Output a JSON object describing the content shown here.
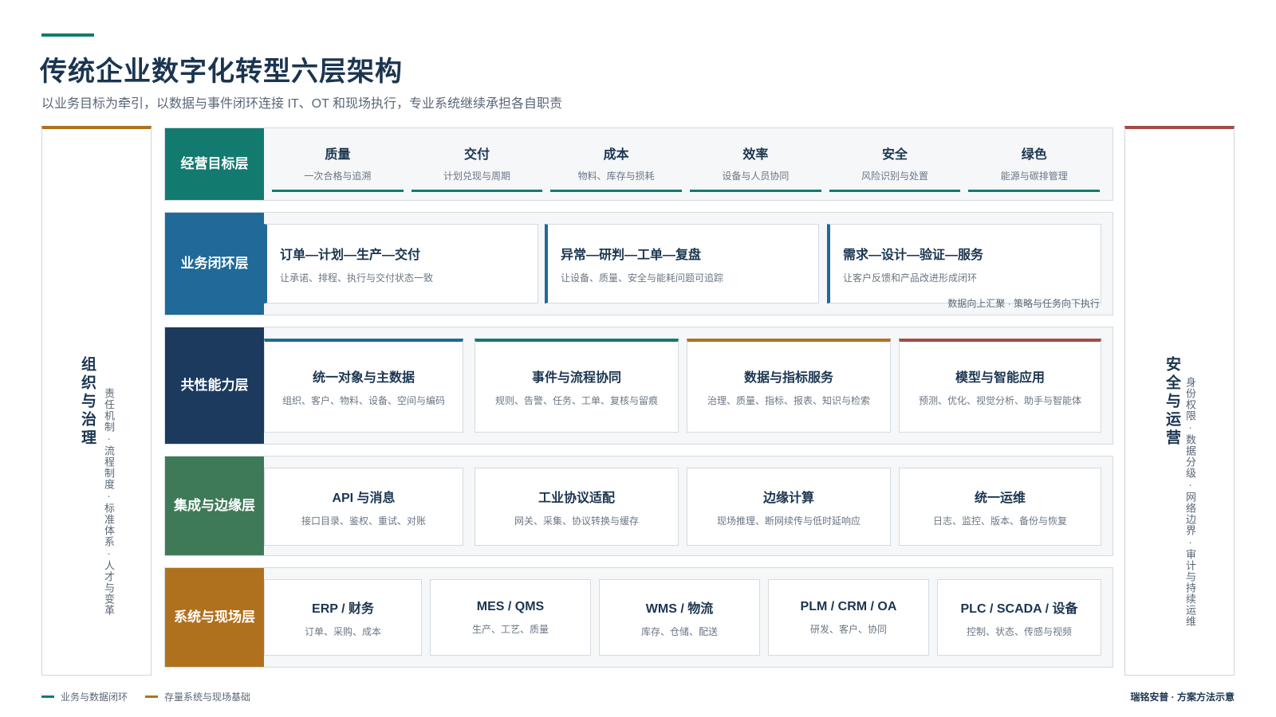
{
  "header": {
    "title": "传统企业数字化转型六层架构",
    "subtitle": "以业务目标为牵引，以数据与事件闭环连接 IT、OT 和现场执行，专业系统继续承担各自职责"
  },
  "left_panel": {
    "title": "组织与治理",
    "desc": "责任机制·流程制度·标准体系·人才与变革"
  },
  "right_panel": {
    "title": "安全与运营",
    "desc": "身份权限·数据分级·网络边界·审计与持续运维"
  },
  "layers": [
    {
      "label": "经营目标层",
      "color": "#137a70",
      "items": [
        {
          "title": "质量",
          "desc": "一次合格与追溯"
        },
        {
          "title": "交付",
          "desc": "计划兑现与周期"
        },
        {
          "title": "成本",
          "desc": "物料、库存与损耗"
        },
        {
          "title": "效率",
          "desc": "设备与人员协同"
        },
        {
          "title": "安全",
          "desc": "风险识别与处置"
        },
        {
          "title": "绿色",
          "desc": "能源与碳排管理"
        }
      ]
    },
    {
      "label": "业务闭环层",
      "color": "#1f6a98",
      "items": [
        {
          "title": "订单—计划—生产—交付",
          "desc": "让承诺、排程、执行与交付状态一致"
        },
        {
          "title": "异常—研判—工单—复盘",
          "desc": "让设备、质量、安全与能耗问题可追踪"
        },
        {
          "title": "需求—设计—验证—服务",
          "desc": "让客户反馈和产品改进形成闭环"
        }
      ],
      "note": "数据向上汇聚 · 策略与任务向下执行"
    },
    {
      "label": "共性能力层",
      "color": "#1b3a5e",
      "items": [
        {
          "title": "统一对象与主数据",
          "desc": "组织、客户、物料、设备、空间与编码",
          "accent": "#1f6a98"
        },
        {
          "title": "事件与流程协同",
          "desc": "规则、告警、任务、工单、复核与留痕",
          "accent": "#137a70"
        },
        {
          "title": "数据与指标服务",
          "desc": "治理、质量、指标、报表、知识与检索",
          "accent": "#b0711e"
        },
        {
          "title": "模型与智能应用",
          "desc": "预测、优化、视觉分析、助手与智能体",
          "accent": "#a84a45"
        }
      ]
    },
    {
      "label": "集成与边缘层",
      "color": "#3f7a58",
      "items": [
        {
          "title": "API 与消息",
          "desc": "接口目录、鉴权、重试、对账"
        },
        {
          "title": "工业协议适配",
          "desc": "网关、采集、协议转换与缓存"
        },
        {
          "title": "边缘计算",
          "desc": "现场推理、断网续传与低时延响应"
        },
        {
          "title": "统一运维",
          "desc": "日志、监控、版本、备份与恢复"
        }
      ]
    },
    {
      "label": "系统与现场层",
      "color": "#b0711e",
      "items": [
        {
          "title": "ERP / 财务",
          "desc": "订单、采购、成本"
        },
        {
          "title": "MES / QMS",
          "desc": "生产、工艺、质量"
        },
        {
          "title": "WMS / 物流",
          "desc": "库存、仓储、配送"
        },
        {
          "title": "PLM / CRM / OA",
          "desc": "研发、客户、协同"
        },
        {
          "title": "PLC / SCADA / 设备",
          "desc": "控制、状态、传感与视频"
        }
      ]
    }
  ],
  "legend": [
    {
      "label": "业务与数据闭环",
      "color": "#137a70"
    },
    {
      "label": "存量系统与现场基础",
      "color": "#b0711e"
    }
  ],
  "brand": "瑞铭安普 · 方案方法示意"
}
